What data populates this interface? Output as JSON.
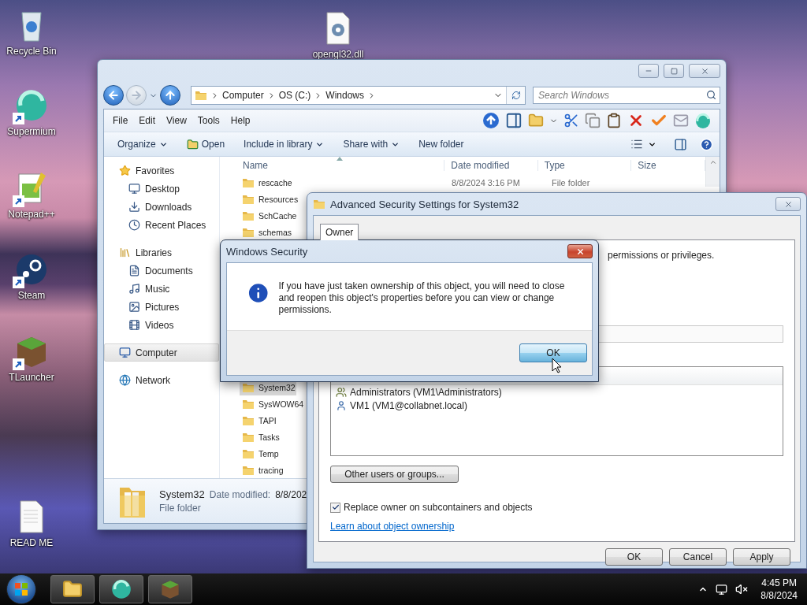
{
  "desktop_icons": [
    {
      "label": "Recycle Bin",
      "shortcut": false
    },
    {
      "label": "Supermium",
      "shortcut": true
    },
    {
      "label": "Notepad++",
      "shortcut": true
    },
    {
      "label": "Steam",
      "shortcut": true
    },
    {
      "label": "TLauncher",
      "shortcut": true
    },
    {
      "label": "READ ME",
      "shortcut": false
    },
    {
      "label": "opengl32.dll",
      "shortcut": false
    }
  ],
  "explorer": {
    "breadcrumb": [
      "Computer",
      "OS (C:)",
      "Windows"
    ],
    "search": {
      "placeholder": "Search Windows"
    },
    "menu": [
      "File",
      "Edit",
      "View",
      "Tools",
      "Help"
    ],
    "commands": [
      {
        "label": "Organize",
        "has_menu": true
      },
      {
        "label": "Open",
        "has_menu": false
      },
      {
        "label": "Include in library",
        "has_menu": true
      },
      {
        "label": "Share with",
        "has_menu": true
      },
      {
        "label": "New folder",
        "has_menu": false
      }
    ],
    "navigation": [
      {
        "label": "Favorites",
        "selected": false,
        "children": [
          {
            "label": "Desktop",
            "selected": false
          },
          {
            "label": "Downloads",
            "selected": false
          },
          {
            "label": "Recent Places",
            "selected": false
          }
        ]
      },
      {
        "label": "Libraries",
        "selected": false,
        "children": [
          {
            "label": "Documents",
            "selected": false
          },
          {
            "label": "Music",
            "selected": false
          },
          {
            "label": "Pictures",
            "selected": false
          },
          {
            "label": "Videos",
            "selected": false
          }
        ]
      },
      {
        "label": "Computer",
        "selected": true
      },
      {
        "label": "Network",
        "selected": false
      }
    ],
    "columns": [
      "Name",
      "Date modified",
      "Type",
      "Size"
    ],
    "file_groups": [
      {
        "files": [
          {
            "name": "rescache",
            "date_modified": "8/8/2024 3:16 PM",
            "type": "File folder",
            "selected": false
          },
          {
            "name": "Resources",
            "selected": false
          },
          {
            "name": "SchCache",
            "selected": false
          },
          {
            "name": "schemas",
            "selected": false
          }
        ]
      },
      {
        "files": [
          {
            "name": "System32",
            "selected": true
          },
          {
            "name": "SysWOW64",
            "selected": false
          },
          {
            "name": "TAPI",
            "selected": false
          },
          {
            "name": "Tasks",
            "selected": false
          },
          {
            "name": "Temp",
            "selected": false
          },
          {
            "name": "tracing",
            "selected": false
          }
        ]
      }
    ],
    "details": {
      "name": "System32",
      "date_label": "Date modified:",
      "date_value": "8/8/202",
      "type": "File folder"
    }
  },
  "security_settings": {
    "title": "Advanced Security Settings for System32",
    "tabs": [
      {
        "label": "Owner",
        "selected": true
      }
    ],
    "description": "permissions or privileges.",
    "owners": [
      {
        "name": "Administrators (VM1\\Administrators)",
        "kind": "group"
      },
      {
        "name": "VM1 (VM1@collabnet.local)",
        "kind": "user"
      }
    ],
    "other_button": "Other users or groups...",
    "replace_owner": {
      "label": "Replace owner on subcontainers and objects",
      "checked": true
    },
    "link": "Learn about object ownership",
    "buttons": [
      "OK",
      "Cancel",
      "Apply"
    ]
  },
  "message_box": {
    "title": "Windows Security",
    "message": "If you have just taken ownership of this object, you will need to close and reopen this object's properties before you can view or change permissions.",
    "button": "OK"
  },
  "taskbar": {
    "time": "4:45 PM",
    "date": "8/8/2024"
  }
}
